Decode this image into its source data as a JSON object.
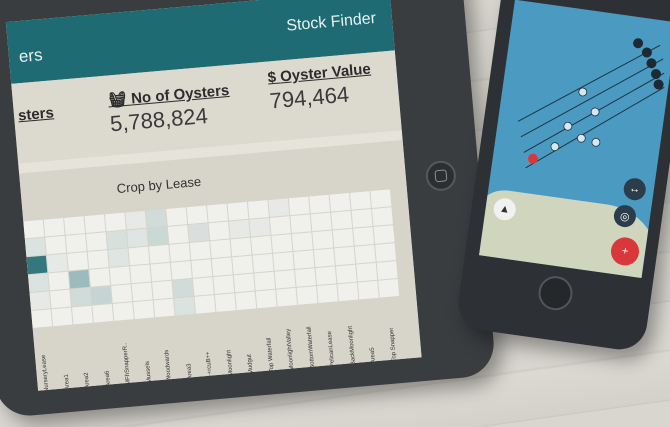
{
  "tablet": {
    "header": {
      "left_title": "ers",
      "right_title": "Stock Finder"
    },
    "stats": [
      {
        "label": "sters",
        "value": ""
      },
      {
        "label": "No of Oysters",
        "value": "5,788,824"
      },
      {
        "label": "Oyster Value",
        "value": "794,464"
      }
    ],
    "chart": {
      "title": "Crop by Lease",
      "xlabels": [
        "NurseryLease",
        "Area1",
        "Area2",
        "Area6",
        "MFhSnapperR..",
        "Mussels",
        "Woodwards",
        "Area3",
        "++rcuB++",
        "Moonlight",
        "Mudgut",
        "Top Waterfall",
        "MoonlightValley",
        "BottomWaterfall",
        "PelicanLease",
        "BackMoonlight",
        "Area5",
        "Top Snapper"
      ]
    }
  },
  "chart_data": {
    "type": "heatmap",
    "title": "Crop by Lease",
    "columns": [
      "NurseryLease",
      "Area1",
      "Area2",
      "Area6",
      "MFhSnapperR..",
      "Mussels",
      "Woodwards",
      "Area3",
      "++rcuB++",
      "Moonlight",
      "Mudgut",
      "Top Waterfall",
      "MoonlightValley",
      "BottomWaterfall",
      "PelicanLease",
      "BackMoonlight",
      "Area5",
      "Top Snapper"
    ],
    "note_values": "relative shading 0-1 per cell",
    "rows": [
      [
        0,
        0,
        0,
        0,
        0,
        0.05,
        0.15,
        0,
        0,
        0,
        0,
        0,
        0.05,
        0,
        0,
        0,
        0,
        0
      ],
      [
        0.1,
        0,
        0,
        0,
        0.12,
        0.08,
        0.18,
        0,
        0.12,
        0,
        0.05,
        0.05,
        0,
        0,
        0,
        0,
        0,
        0
      ],
      [
        0.9,
        0.05,
        0,
        0,
        0.08,
        0,
        0,
        0,
        0,
        0,
        0,
        0,
        0,
        0,
        0,
        0,
        0,
        0
      ],
      [
        0.1,
        0,
        0.4,
        0,
        0,
        0,
        0,
        0,
        0,
        0,
        0,
        0,
        0,
        0,
        0,
        0,
        0,
        0
      ],
      [
        0.05,
        0,
        0.15,
        0.2,
        0,
        0,
        0,
        0.15,
        0,
        0,
        0,
        0,
        0,
        0,
        0,
        0,
        0,
        0
      ],
      [
        0,
        0,
        0,
        0,
        0,
        0,
        0,
        0.1,
        0,
        0,
        0,
        0,
        0,
        0,
        0,
        0,
        0,
        0
      ]
    ]
  },
  "phone": {
    "markers": [
      1,
      2,
      3,
      4,
      5
    ]
  }
}
